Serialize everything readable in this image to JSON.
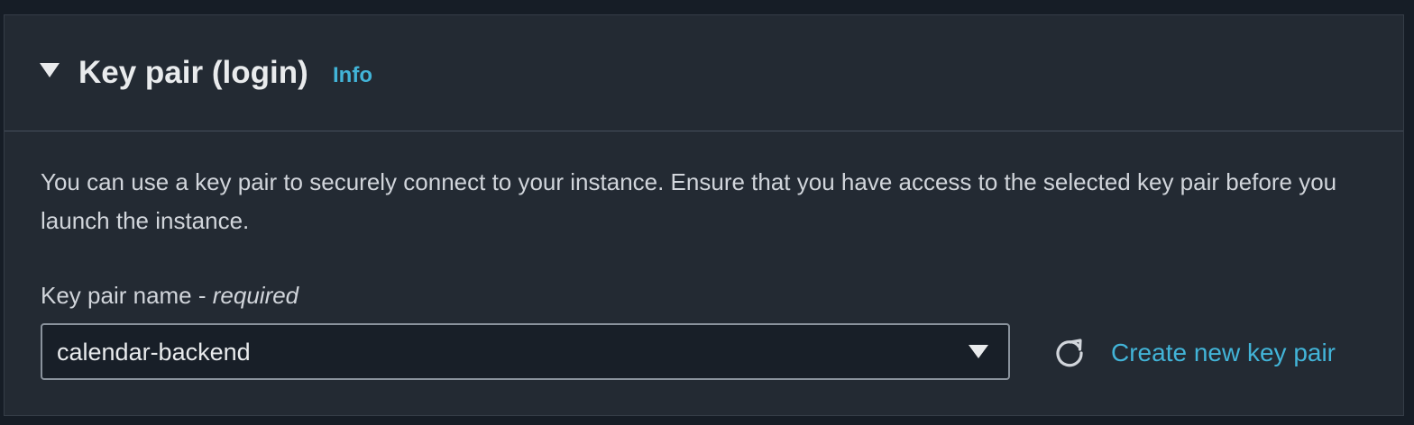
{
  "section": {
    "title": "Key pair (login)",
    "info_label": "Info",
    "description": "You can use a key pair to securely connect to your instance. Ensure that you have access to the selected key pair before you launch the instance."
  },
  "key_pair_field": {
    "label": "Key pair name - ",
    "required_label": "required",
    "selected_value": "calendar-backend"
  },
  "actions": {
    "refresh_icon": "refresh-icon",
    "create_link": "Create new key pair"
  },
  "colors": {
    "background": "#161d26",
    "panel": "#232a33",
    "link": "#42b4d8",
    "text": "#e9ebed"
  }
}
